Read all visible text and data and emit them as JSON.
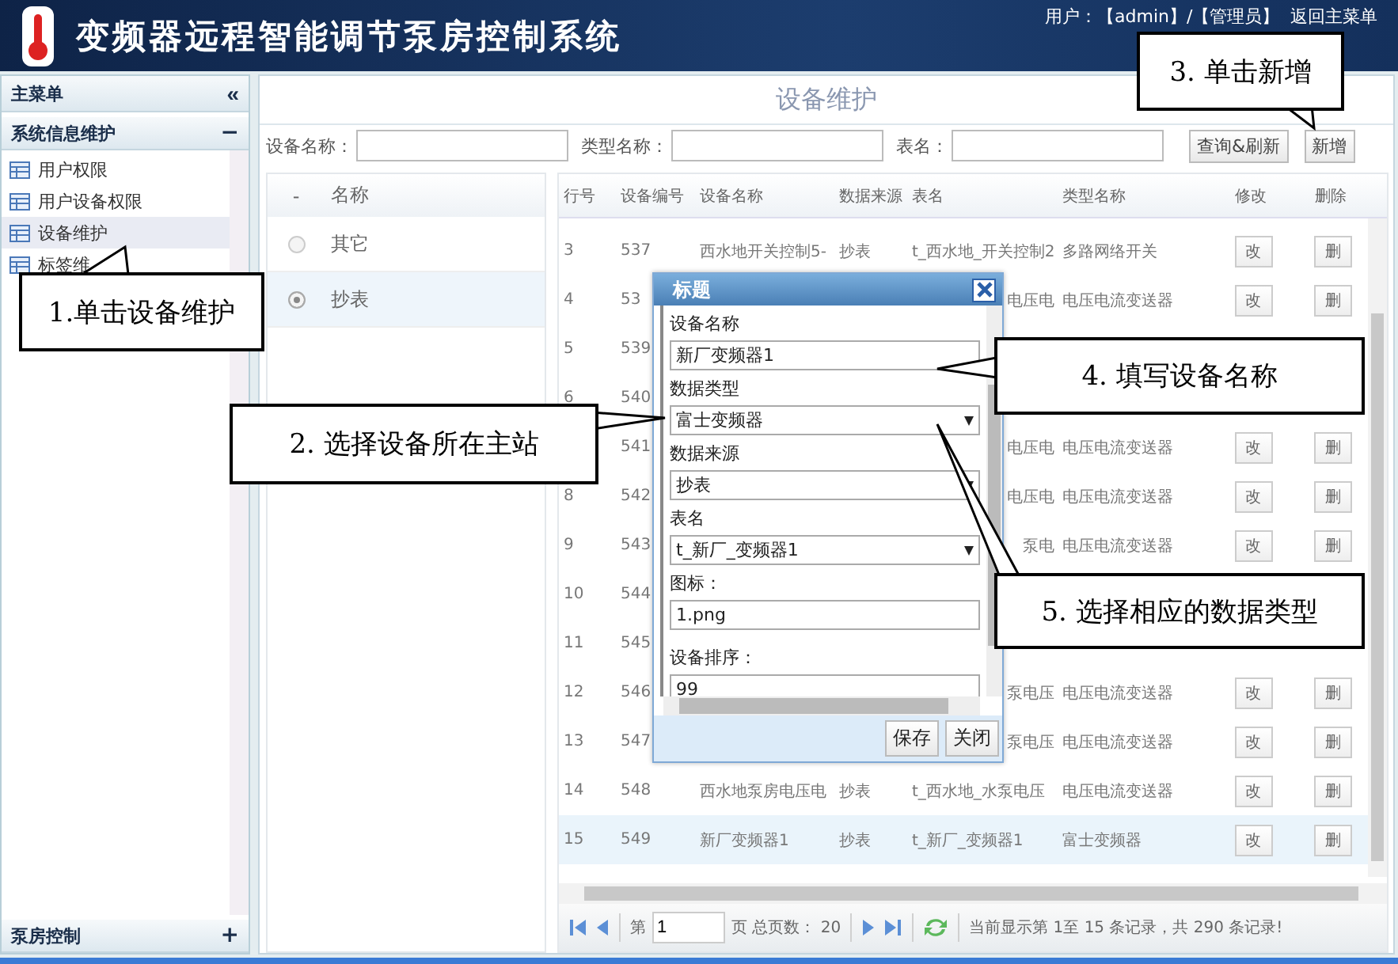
{
  "header": {
    "title": "变频器远程智能调节泵房控制系统",
    "user": "用户：【admin】/【管理员】",
    "home_link": "返回主菜单"
  },
  "sidebar": {
    "title": "主菜单",
    "collapse": "«",
    "groups": [
      {
        "label": "系统信息维护",
        "toggle": "−",
        "expanded": true,
        "items": [
          {
            "label": "用户权限",
            "selected": false
          },
          {
            "label": "用户设备权限",
            "selected": false
          },
          {
            "label": "设备维护",
            "selected": true
          },
          {
            "label": "标签维",
            "selected": false
          }
        ]
      },
      {
        "label": "泵房控制",
        "toggle": "+",
        "expanded": false
      }
    ]
  },
  "page": {
    "title": "设备维护"
  },
  "search": {
    "fields": [
      {
        "label": "设备名称："
      },
      {
        "label": "类型名称："
      },
      {
        "label": "表名："
      }
    ],
    "buttons": [
      "查询&刷新",
      "新增"
    ]
  },
  "station_list": {
    "columns": [
      "-",
      "名称"
    ],
    "rows": [
      {
        "name": "其它",
        "selected": false
      },
      {
        "name": "抄表",
        "selected": true
      }
    ]
  },
  "device_table": {
    "columns": [
      "行号",
      "设备编号",
      "设备名称",
      "数据来源",
      "表名",
      "类型名称",
      "修改",
      "删除"
    ],
    "rows": [
      {
        "no": "3",
        "id": "537",
        "name": "西水地开关控制5-",
        "source": "抄表",
        "table": "t_西水地_开关控制2",
        "type": "多路网络开关",
        "edit": "改",
        "delete": "删",
        "selected": false
      },
      {
        "no": "4",
        "id": "53",
        "table_tail": "电压电",
        "type": "电压电流变送器",
        "edit": "改",
        "delete": "删",
        "selected": false
      },
      {
        "no": "5",
        "id": "539",
        "selected": false
      },
      {
        "no": "6",
        "id": "540",
        "selected": false
      },
      {
        "id": "541",
        "table_tail": "电压电",
        "type": "电压电流变送器",
        "edit": "改",
        "delete": "删",
        "selected": false
      },
      {
        "no": "8",
        "id": "542",
        "table_tail": "电压电",
        "type": "电压电流变送器",
        "edit": "改",
        "delete": "删",
        "selected": false
      },
      {
        "no": "9",
        "id": "543",
        "table_tail": "泵电",
        "type": "电压电流变送器",
        "edit": "改",
        "delete": "删",
        "selected": false
      },
      {
        "no": "10",
        "id": "544",
        "selected": false
      },
      {
        "no": "11",
        "id": "545",
        "selected": false
      },
      {
        "no": "12",
        "id": "546",
        "table_tail": "泵电压",
        "type": "电压电流变送器",
        "edit": "改",
        "delete": "删",
        "selected": false
      },
      {
        "no": "13",
        "id": "547",
        "table_tail": "泵电压",
        "type": "电压电流变送器",
        "edit": "改",
        "delete": "删",
        "selected": false
      },
      {
        "no": "14",
        "id": "548",
        "name": "西水地泵房电压电",
        "source": "抄表",
        "table": "t_西水地_水泵电压",
        "type": "电压电流变送器",
        "edit": "改",
        "delete": "删",
        "selected": false
      },
      {
        "no": "15",
        "id": "549",
        "name": "新厂变频器1",
        "source": "抄表",
        "table": "t_新厂_变频器1",
        "type": "富士变频器",
        "edit": "改",
        "delete": "删",
        "selected": true
      }
    ]
  },
  "pagination": {
    "page_label": "第",
    "page": "1",
    "total": "页 总页数： 20",
    "status": "当前显示第 1至 15 条记录，共 290 条记录!"
  },
  "dialog": {
    "title": "标题",
    "fields": [
      {
        "kind": "text",
        "label": "设备名称",
        "value": "新厂变频器1"
      },
      {
        "kind": "select",
        "label": "数据类型",
        "value": "富士变频器"
      },
      {
        "kind": "select",
        "label": "数据来源",
        "value": "抄表"
      },
      {
        "kind": "select",
        "label": "表名",
        "value": "t_新厂_变频器1"
      },
      {
        "kind": "text",
        "label": "图标：",
        "value": "1.png"
      },
      {
        "kind": "text",
        "label": "设备排序：",
        "value": "99"
      }
    ],
    "buttons": [
      "保存",
      "关闭"
    ]
  },
  "callouts": [
    {
      "text": "1.单击设备维护"
    },
    {
      "text": "2. 选择设备所在主站"
    },
    {
      "text": "3. 单击新增"
    },
    {
      "text": "4. 填写设备名称"
    },
    {
      "text": "5. 选择相应的数据类型"
    }
  ]
}
